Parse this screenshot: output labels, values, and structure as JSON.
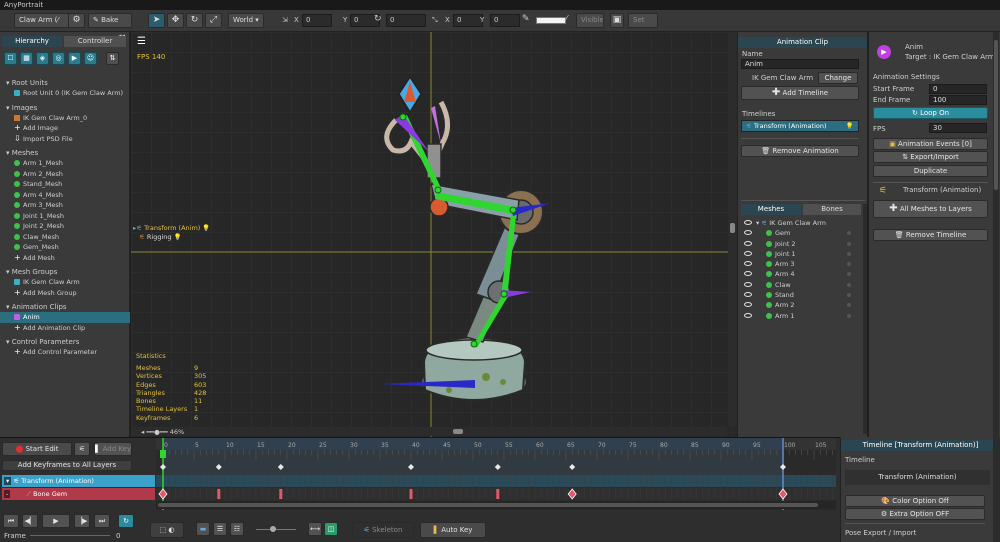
{
  "app": {
    "title": "AnyPortrait"
  },
  "toolbar": {
    "object_name": "Claw Arm (⁄",
    "bake_label": "Bake",
    "space_select": "World",
    "pos_x_label": "X",
    "pos_x": "0",
    "pos_y_label": "Y",
    "pos_y": "0",
    "rot_value": "0",
    "scale_x_label": "X",
    "scale_x": "0",
    "scale_y_label": "Y",
    "scale_y": "0",
    "visible_label": "Visible",
    "set_label": "Set"
  },
  "hierarchy": {
    "tab_hierarchy": "Hierarchy",
    "tab_controller": "Controller",
    "sections": {
      "root_units": "Root Units",
      "root_unit_item": "Root Unit 0 (IK Gem Claw Arm)",
      "images": "Images",
      "image_item": "IK Gem Claw Arm_0",
      "add_image": "Add Image",
      "import_psd": "Import PSD File",
      "meshes": "Meshes",
      "mesh_items": [
        "Arm 1_Mesh",
        "Arm 2_Mesh",
        "Stand_Mesh",
        "Arm 4_Mesh",
        "Arm 3_Mesh",
        "Joint 1_Mesh",
        "Joint 2_Mesh",
        "Claw_Mesh",
        "Gem_Mesh"
      ],
      "add_mesh": "Add Mesh",
      "mesh_groups": "Mesh Groups",
      "mesh_group_item": "IK Gem Claw Arm",
      "add_mesh_group": "Add Mesh Group",
      "animation_clips": "Animation Clips",
      "anim_item": "Anim",
      "add_anim_clip": "Add Animation Clip",
      "control_params": "Control Parameters",
      "add_control_param": "Add Control Parameter"
    }
  },
  "viewport": {
    "fps": "FPS 140",
    "layer_transform": "Transform (Anim)",
    "layer_rigging": "Rigging",
    "stats": {
      "title": "Statistics",
      "rows": [
        {
          "k": "Meshes",
          "v": "9"
        },
        {
          "k": "Vertices",
          "v": "305"
        },
        {
          "k": "Edges",
          "v": "603"
        },
        {
          "k": "Triangles",
          "v": "428"
        },
        {
          "k": "Bones",
          "v": "11"
        },
        {
          "k": "Timeline Layers",
          "v": "1"
        },
        {
          "k": "Keyframes",
          "v": "6"
        }
      ]
    },
    "zoom": "46%"
  },
  "clip_panel": {
    "header": "Animation Clip",
    "name_label": "Name",
    "name_value": "Anim",
    "target_value": "IK Gem Claw Arm",
    "change_label": "Change",
    "add_timeline": "Add Timeline",
    "timelines_label": "Timelines",
    "timeline_item": "Transform (Animation)",
    "remove_animation": "Remove Animation",
    "tab_meshes": "Meshes",
    "tab_bones": "Bones",
    "root_item": "IK Gem Claw Arm",
    "items": [
      "Gem",
      "Joint 2",
      "Joint 1",
      "Arm 3",
      "Arm 4",
      "Claw",
      "Stand",
      "Arm 2",
      "Arm 1"
    ]
  },
  "props_panel": {
    "anim_name": "Anim",
    "target": "Target : IK Gem Claw Arm",
    "settings_label": "Animation Settings",
    "start_frame_label": "Start Frame",
    "start_frame": "0",
    "end_frame_label": "End Frame",
    "end_frame": "100",
    "loop_on": "Loop On",
    "fps_label": "FPS",
    "fps_value": "30",
    "anim_events": "Animation Events [0]",
    "export_import": "Export/Import",
    "duplicate": "Duplicate",
    "timeline_title": "Transform (Animation)",
    "all_meshes_to_layers": "All Meshes to Layers",
    "remove_timeline": "Remove Timeline"
  },
  "timeline": {
    "start_edit": "Start Edit",
    "add_key": "Add Key",
    "add_keyframes_all": "Add Keyframes to All Layers",
    "track_transform": "Transform (Animation)",
    "track_bone": "Bone Gem",
    "ticks": [
      "0",
      "5",
      "10",
      "15",
      "20",
      "25",
      "30",
      "35",
      "40",
      "45",
      "50",
      "55",
      "60",
      "65",
      "70",
      "75",
      "80",
      "85",
      "90",
      "95",
      "100",
      "105"
    ],
    "frame_label": "Frame",
    "frame_value": "0",
    "frame_end": "100",
    "skeleton_label": "Skeleton",
    "auto_key": "Auto Key",
    "key_summary_frames": [
      0,
      9,
      19,
      40,
      54,
      66,
      100
    ],
    "key_bone_frames": [
      0,
      9,
      19,
      40,
      54,
      66,
      100
    ]
  },
  "timeline_props": {
    "header": "Timeline [Transform (Animation)]",
    "timeline_label": "Timeline",
    "timeline_value": "Transform (Animation)",
    "color_option": "Color Option Off",
    "extra_option": "Extra Option OFF",
    "pose_export": "Pose Export / Import"
  },
  "colors": {
    "accent": "#2a6e80",
    "track_selected": "#3aa2c8",
    "track_bone": "#b03a4a",
    "keyframe_red": "#e05a6a",
    "bone_green": "#2fd62f",
    "bone_blue": "#2a28c8",
    "bone_purple": "#8a3ae0"
  }
}
